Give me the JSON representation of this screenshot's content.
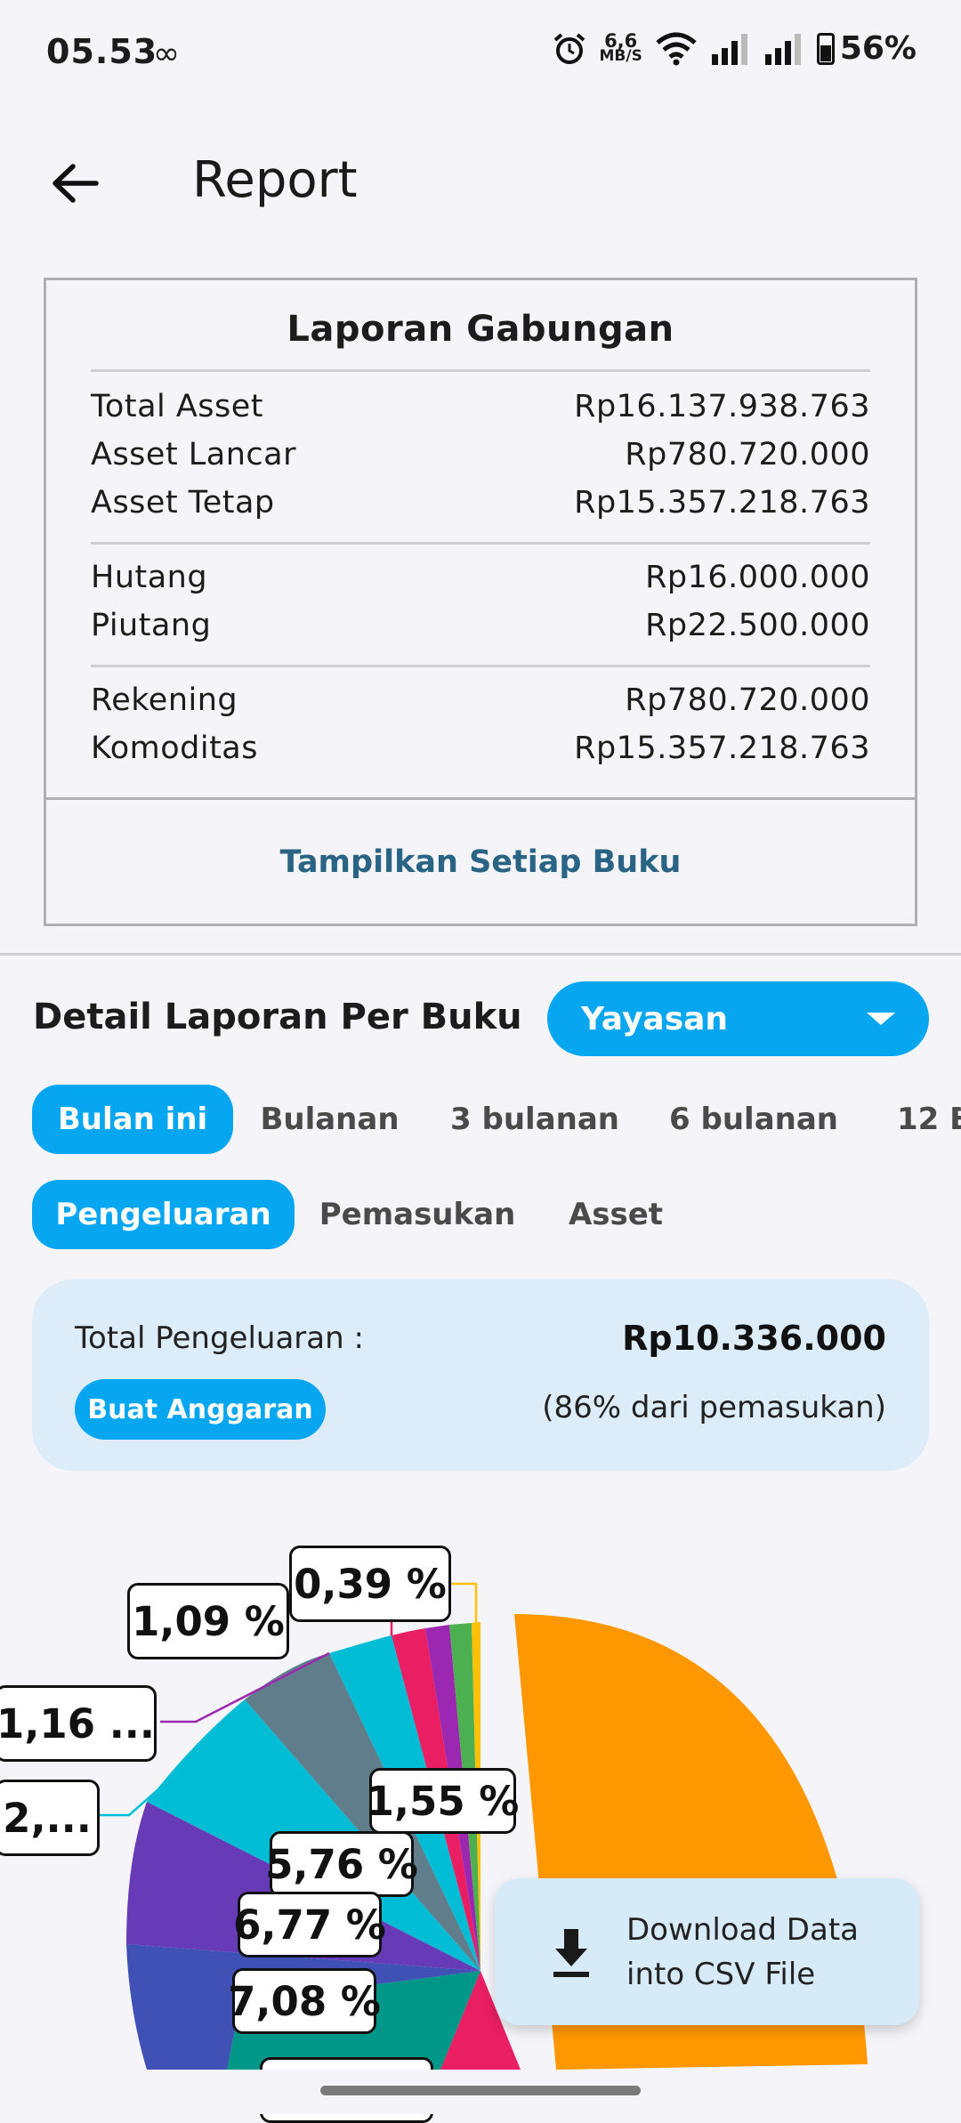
{
  "status_bar": {
    "time": "05.53",
    "infinity_icon": "∞",
    "net_speed_value": "6,6",
    "net_speed_unit": "MB/S",
    "battery": "56%"
  },
  "header": {
    "title": "Report"
  },
  "summary": {
    "title": "Laporan Gabungan",
    "rows_assets": [
      {
        "label": "Total Asset",
        "value": "Rp16.137.938.763"
      },
      {
        "label": "Asset Lancar",
        "value": "Rp780.720.000"
      },
      {
        "label": "Asset Tetap",
        "value": "Rp15.357.218.763"
      }
    ],
    "rows_debts": [
      {
        "label": "Hutang",
        "value": "Rp16.000.000"
      },
      {
        "label": "Piutang",
        "value": "Rp22.500.000"
      }
    ],
    "rows_accounts": [
      {
        "label": "Rekening",
        "value": "Rp780.720.000"
      },
      {
        "label": "Komoditas",
        "value": "Rp15.357.218.763"
      }
    ],
    "show_each_label": "Tampilkan Setiap Buku"
  },
  "detail": {
    "title": "Detail Laporan Per Buku",
    "book_selected": "Yayasan",
    "period_tabs": [
      "Bulan ini",
      "Bulanan",
      "3 bulanan",
      "6 bulanan",
      "12 B"
    ],
    "period_active": "Bulan ini",
    "type_tabs": [
      "Pengeluaran",
      "Pemasukan",
      "Asset"
    ],
    "type_active": "Pengeluaran"
  },
  "total": {
    "label": "Total Pengeluaran :",
    "value": "Rp10.336.000",
    "budget_button": "Buat Anggaran",
    "percent_note": "(86% dari pemasukan)"
  },
  "chart_data": {
    "type": "pie",
    "labels_shown": [
      "0,39 %",
      "1,09 %",
      "1,16 ...",
      "2,...",
      "1,55 %",
      "5,76 %",
      "6,77 %",
      "7,08 %"
    ],
    "colors": [
      "#ff9800",
      "#e91e63",
      "#009688",
      "#3f51b5",
      "#673ab7",
      "#00bcd4",
      "#607d8b",
      "#00bcd4",
      "#e91e63",
      "#9c27b0",
      "#4caf50",
      "#ffc107"
    ]
  },
  "download": {
    "line1": "Download Data",
    "line2": "into CSV File"
  },
  "icons": {
    "back": "arrow-left-icon",
    "alarm": "alarm-icon",
    "wifi": "wifi-icon",
    "signal": "signal-icon",
    "battery": "battery-icon",
    "dropdown": "chevron-down-icon",
    "download": "download-icon"
  }
}
